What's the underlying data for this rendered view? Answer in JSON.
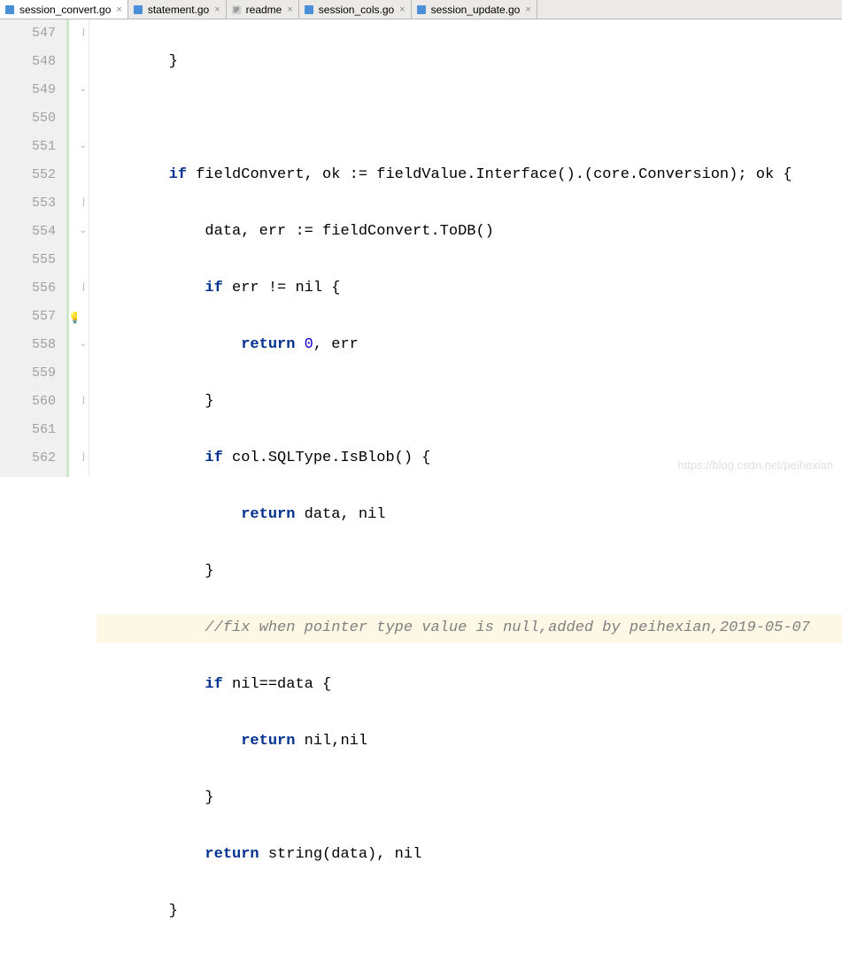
{
  "tabs": [
    {
      "label": "session_convert.go",
      "icon": "go",
      "active": true
    },
    {
      "label": "statement.go",
      "icon": "go",
      "active": false
    },
    {
      "label": "readme",
      "icon": "text",
      "active": false
    },
    {
      "label": "session_cols.go",
      "icon": "go",
      "active": false
    },
    {
      "label": "session_update.go",
      "icon": "go",
      "active": false
    }
  ],
  "lines": {
    "start": 547,
    "end": 562,
    "highlighted": 557
  },
  "code": {
    "l547": "}",
    "l548": "",
    "l549a": "if",
    "l549b": " fieldConvert, ok := fieldValue.Interface().(core.Conversion); ok {",
    "l550": "data, err := fieldConvert.ToDB()",
    "l551a": "if",
    "l551b": " err != nil {",
    "l552a": "return ",
    "l552b": "0",
    "l552c": ", err",
    "l553": "}",
    "l554a": "if",
    "l554b": " col.SQLType.IsBlob() {",
    "l555a": "return",
    "l555b": " data, nil",
    "l556": "}",
    "l557": "//fix when pointer type value is null,added by peihexian,2019-05-07",
    "l558a": "if",
    "l558b": " nil==data {",
    "l559a": "return",
    "l559b": " nil,nil",
    "l560": "}",
    "l561a": "return",
    "l561b": " string(data), nil",
    "l562": "}"
  },
  "watermark": "https://blog.csdn.net/peihexian"
}
